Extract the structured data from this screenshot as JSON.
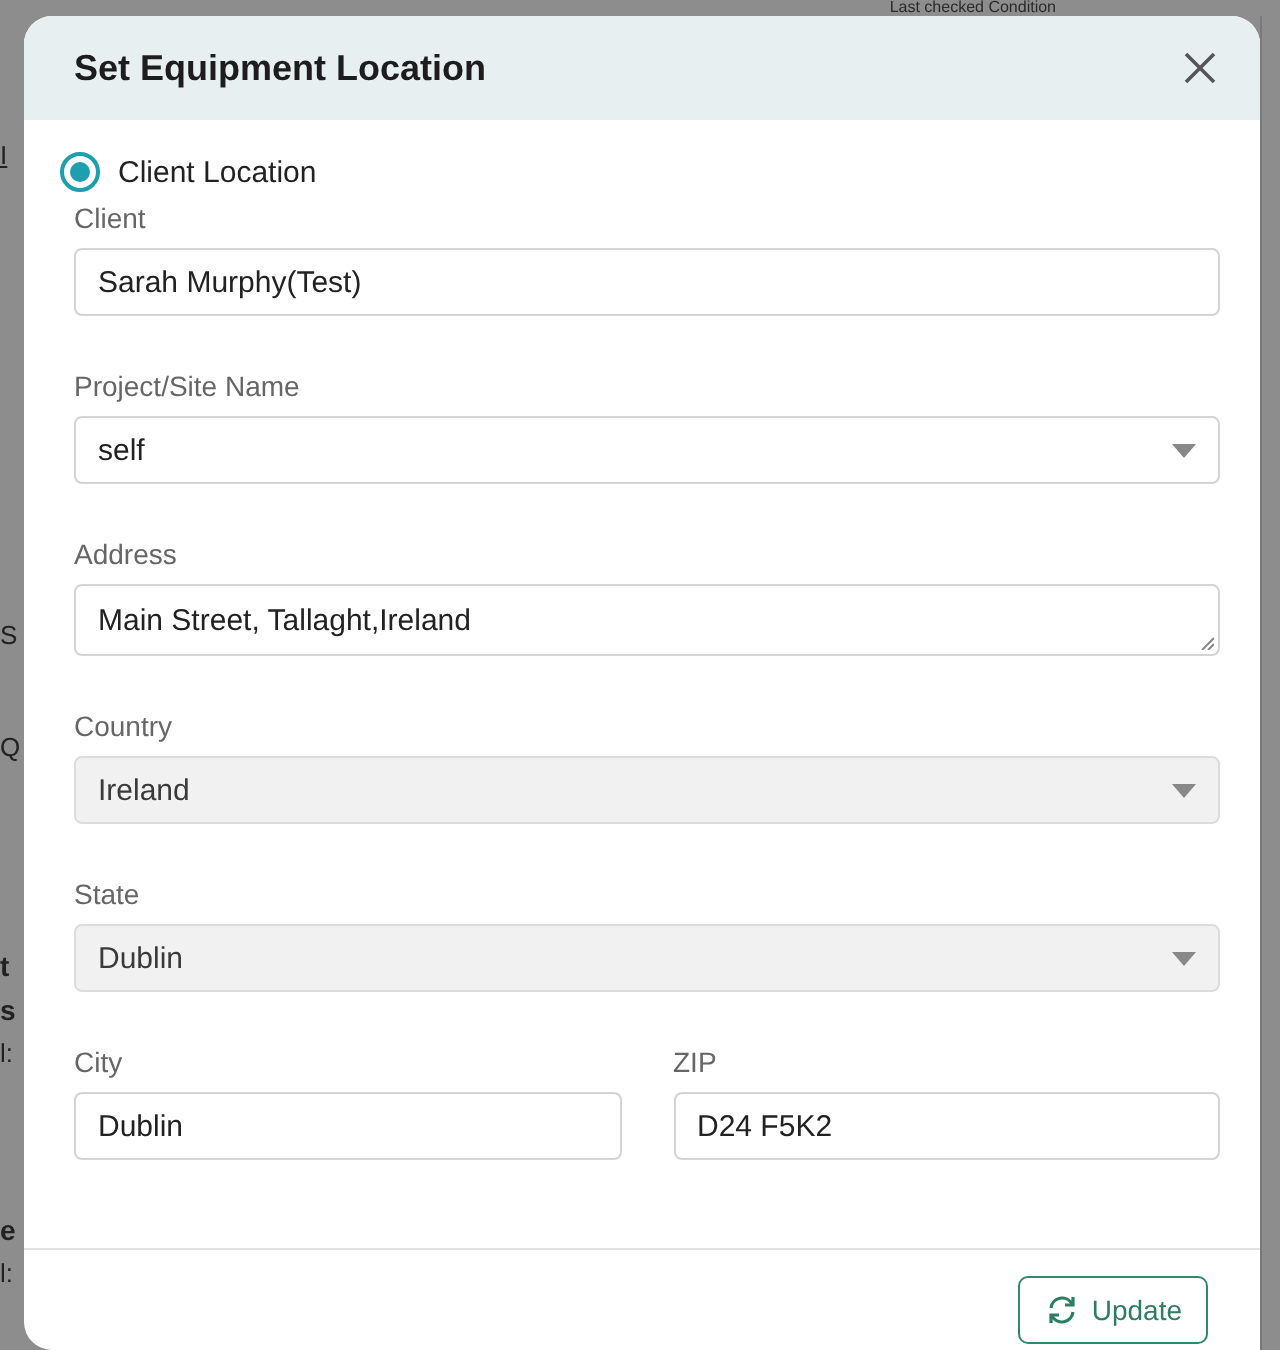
{
  "background": {
    "header_text": "Last checked Condition",
    "edge_texts": [
      {
        "text": "I",
        "kind": "link"
      },
      {
        "text": "S",
        "kind": "text"
      },
      {
        "text": "Q",
        "kind": "text"
      },
      {
        "text": "t",
        "kind": "bold"
      },
      {
        "text": "s",
        "kind": "bold"
      },
      {
        "text": "l:",
        "kind": "text"
      },
      {
        "text": "e",
        "kind": "bold"
      },
      {
        "text": "l:",
        "kind": "text"
      }
    ]
  },
  "dialog": {
    "title": "Set Equipment Location",
    "location_options": [
      {
        "label": "Client Location",
        "selected": true
      }
    ],
    "fields": [
      {
        "label": "Client",
        "kind": "text",
        "value": "Sarah Murphy(Test)",
        "disabled": false
      },
      {
        "label": "Project/Site Name",
        "kind": "select",
        "value": "self",
        "disabled": false
      },
      {
        "label": "Address",
        "kind": "textarea",
        "value": "Main Street, Tallaght,Ireland",
        "disabled": false
      },
      {
        "label": "Country",
        "kind": "select",
        "value": "Ireland",
        "disabled": true
      },
      {
        "label": "State",
        "kind": "select",
        "value": "Dublin",
        "disabled": true
      }
    ],
    "inline_fields": [
      {
        "label": "City",
        "kind": "text",
        "value": "Dublin",
        "disabled": false
      },
      {
        "label": "ZIP",
        "kind": "text",
        "value": "D24 F5K2",
        "disabled": false
      }
    ],
    "update_button": "Update"
  }
}
